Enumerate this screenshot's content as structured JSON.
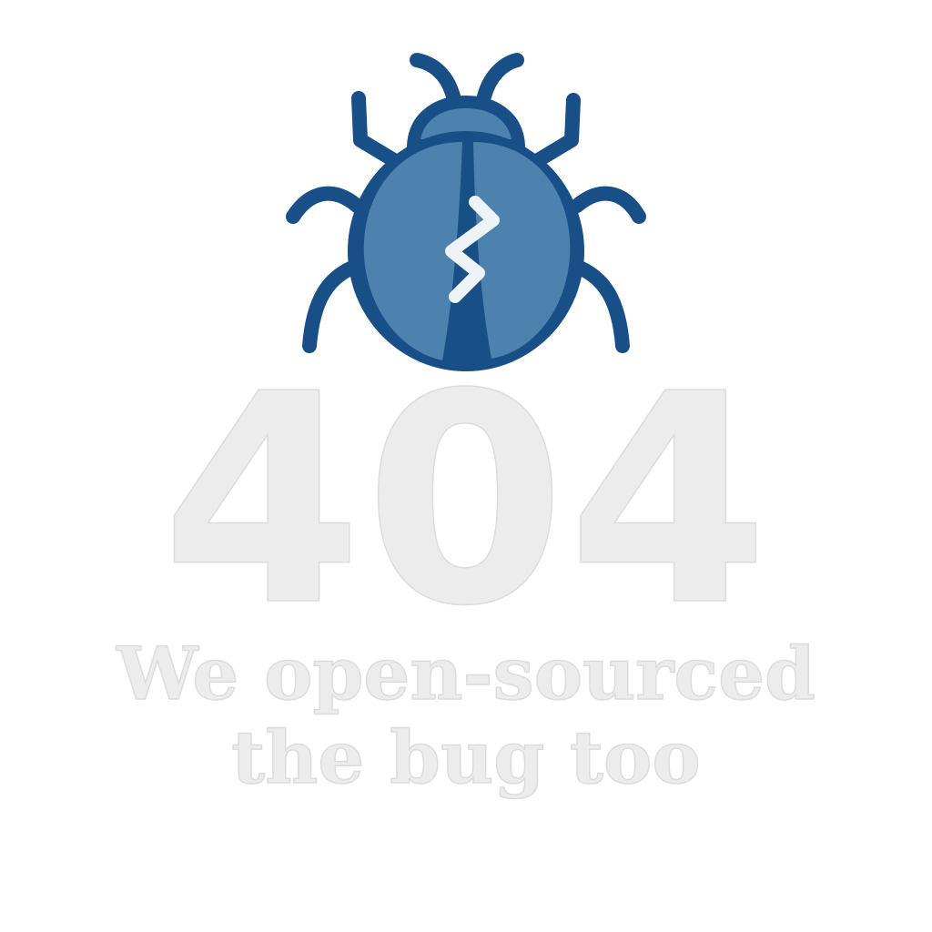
{
  "error": {
    "code": "404",
    "tagline_line1": "We open-sourced",
    "tagline_line2": "the bug too"
  },
  "illustration": {
    "icon": "bug-icon",
    "body_color": "#4c82ad",
    "outline_color": "#184f87",
    "crack_color": "#ffffff"
  },
  "colors": {
    "background": "#ffffff",
    "text": "#ececec",
    "text_outline": "#dcdcdc"
  }
}
